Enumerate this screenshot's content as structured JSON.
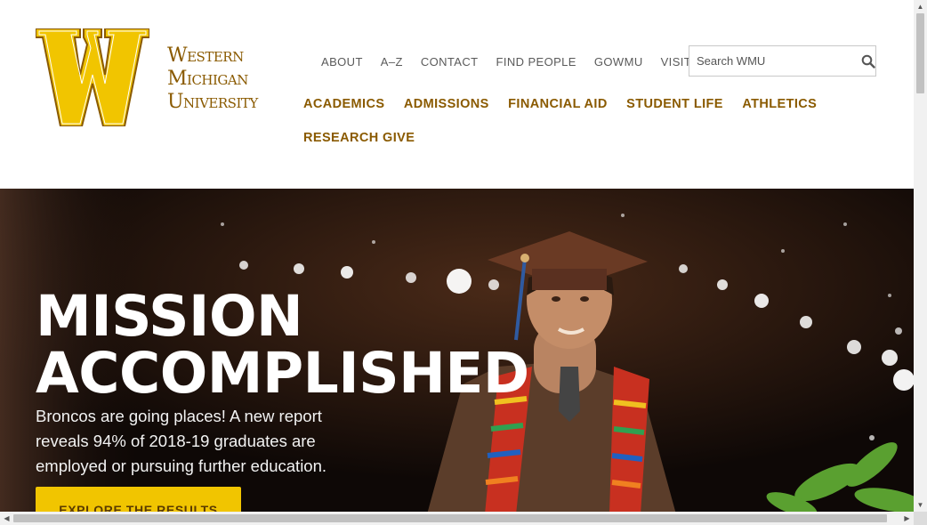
{
  "header": {
    "logo": {
      "letter": "W",
      "wordmark": [
        "Western",
        "Michigan",
        "University"
      ]
    },
    "utility_nav": [
      "ABOUT",
      "A–Z",
      "CONTACT",
      "FIND PEOPLE",
      "GOWMU",
      "VISIT"
    ],
    "search": {
      "placeholder": "Search WMU",
      "icon": "search-icon"
    },
    "main_nav": [
      "ACADEMICS",
      "ADMISSIONS",
      "FINANCIAL AID",
      "STUDENT LIFE",
      "ATHLETICS",
      "RESEARCH",
      "GIVE"
    ]
  },
  "hero": {
    "title_line1": "MISSION",
    "title_line2": "ACCOMPLISHED",
    "text": "Broncos are going places! A new report reveals 94% of 2018-19 graduates are employed or pursuing further education.",
    "cta_label": "EXPLORE THE RESULTS"
  },
  "colors": {
    "brand_brown": "#8a5a00",
    "brand_gold": "#f1c500"
  }
}
